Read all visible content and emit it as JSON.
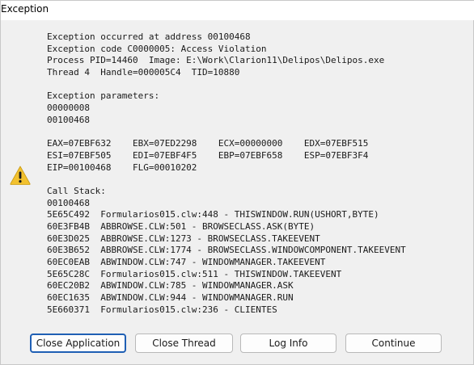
{
  "window": {
    "title": "Exception"
  },
  "icons": {
    "warning": "warning-triangle-icon",
    "warning_color": "#f2c12e"
  },
  "details": {
    "lines": [
      "Exception occurred at address 00100468",
      "Exception code C0000005: Access Violation",
      "Process PID=14460  Image: E:\\Work\\Clarion11\\Delipos\\Delipos.exe",
      "Thread 4  Handle=000005C4  TID=10880",
      "",
      "Exception parameters:",
      "00000008",
      "00100468",
      "",
      "EAX=07EBF632    EBX=07ED2298    ECX=00000000    EDX=07EBF515",
      "ESI=07EBF505    EDI=07EBF4F5    EBP=07EBF658    ESP=07EBF3F4",
      "EIP=00100468    FLG=00010202",
      "",
      "Call Stack:",
      "00100468",
      "5E65C492  Formularios015.clw:448 - THISWINDOW.RUN(USHORT,BYTE)",
      "60E3FB4B  ABBROWSE.CLW:501 - BROWSECLASS.ASK(BYTE)",
      "60E3D025  ABBROWSE.CLW:1273 - BROWSECLASS.TAKEEVENT",
      "60E3B652  ABBROWSE.CLW:1774 - BROWSECLASS.WINDOWCOMPONENT.TAKEEVENT",
      "60EC0EAB  ABWINDOW.CLW:747 - WINDOWMANAGER.TAKEEVENT",
      "5E65C28C  Formularios015.clw:511 - THISWINDOW.TAKEEVENT",
      "60EC20B2  ABWINDOW.CLW:785 - WINDOWMANAGER.ASK",
      "60EC1635  ABWINDOW.CLW:944 - WINDOWMANAGER.RUN",
      "5E660371  Formularios015.clw:236 - CLIENTES"
    ]
  },
  "buttons": {
    "close_application": "Close Application",
    "close_thread": "Close Thread",
    "log_info": "Log Info",
    "continue": "Continue"
  }
}
